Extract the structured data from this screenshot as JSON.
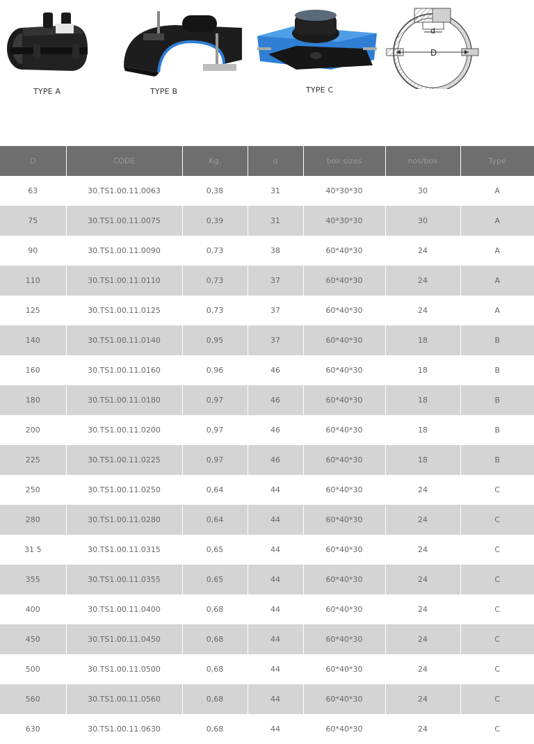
{
  "products": [
    {
      "caption": "TYPE A"
    },
    {
      "caption": "TYPE B"
    },
    {
      "caption": "TYPE C"
    },
    {
      "caption": ""
    }
  ],
  "diagram": {
    "small_d_label": "d",
    "big_d_label": "D"
  },
  "table": {
    "headers": [
      "D",
      "CODE",
      "Kg.",
      "d",
      "box sizes",
      "nos/box",
      "Type"
    ],
    "rows": [
      [
        "63",
        "30.TS1.00.11.0063",
        "0,38",
        "31",
        "40*30*30",
        "30",
        "A"
      ],
      [
        "75",
        "30.TS1.00.11.0075",
        "0,39",
        "31",
        "40*30*30",
        "30",
        "A"
      ],
      [
        "90",
        "30.TS1.00.11.0090",
        "0,73",
        "38",
        "60*40*30",
        "24",
        "A"
      ],
      [
        "110",
        "30.TS1.00.11.0110",
        "0,73",
        "37",
        "60*40*30",
        "24",
        "A"
      ],
      [
        "125",
        "30.TS1.00.11.0125",
        "0,73",
        "37",
        "60*40*30",
        "24",
        "A"
      ],
      [
        "140",
        "30.TS1.00.11.0140",
        "0,95",
        "37",
        "60*40*30",
        "18",
        "B"
      ],
      [
        "160",
        "30.TS1.00.11.0160",
        "0,96",
        "46",
        "60*40*30",
        "18",
        "B"
      ],
      [
        "180",
        "30.TS1.00.11.0180",
        "0,97",
        "46",
        "60*40*30",
        "18",
        "B"
      ],
      [
        "200",
        "30.TS1.00.11.0200",
        "0,97",
        "46",
        "60*40*30",
        "18",
        "B"
      ],
      [
        "225",
        "30.TS1.00.11.0225",
        "0,97",
        "46",
        "60*40*30",
        "18",
        "B"
      ],
      [
        "250",
        "30.TS1.00.11.0250",
        "0,64",
        "44",
        "60*40*30",
        "24",
        "C"
      ],
      [
        "280",
        "30.TS1.00.11.0280",
        "0,64",
        "44",
        "60*40*30",
        "24",
        "C"
      ],
      [
        "31 5",
        "30.TS1.00.11.0315",
        "0,65",
        "44",
        "60*40*30",
        "24",
        "C"
      ],
      [
        "355",
        "30.TS1.00.11.0355",
        "0,65",
        "44",
        "60*40*30",
        "24",
        "C"
      ],
      [
        "400",
        "30.TS1.00.11.0400",
        "0,68",
        "44",
        "60*40*30",
        "24",
        "C"
      ],
      [
        "450",
        "30.TS1.00.11.0450",
        "0,68",
        "44",
        "60*40*30",
        "24",
        "C"
      ],
      [
        "500",
        "30.TS1.00.11.0500",
        "0,68",
        "44",
        "60*40*30",
        "24",
        "C"
      ],
      [
        "560",
        "30.TS1.00.11.0560",
        "0,68",
        "44",
        "60*40*30",
        "24",
        "C"
      ],
      [
        "630",
        "30.TS1.00.11.0630",
        "0,68",
        "44",
        "60*40*30",
        "24",
        "C"
      ]
    ]
  },
  "colors": {
    "header_bg": "#6e6e6e",
    "header_text": "#9a9a9a",
    "alt_row": "#d4d4d4",
    "strap_blue": "#2f7fd4"
  }
}
